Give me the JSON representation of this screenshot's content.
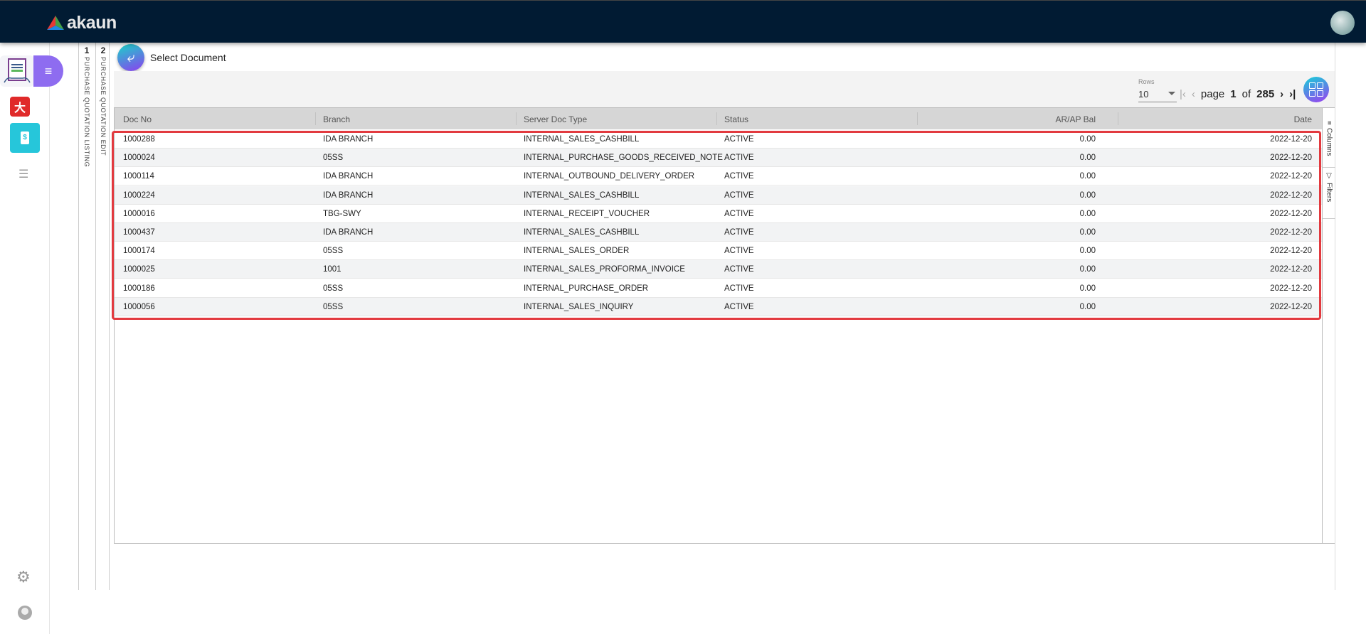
{
  "app": {
    "logo_text": "akaun"
  },
  "steps": [
    {
      "number": "1",
      "label": "PURCHASE QUOTATION LISTING"
    },
    {
      "number": "2",
      "label": "PURCHASE QUOTATION EDIT"
    }
  ],
  "page": {
    "title": "Select Document"
  },
  "pagination": {
    "rows_label": "Rows",
    "rows_value": "10",
    "page_word": "page",
    "current_page": "1",
    "of_word": "of",
    "total_pages": "285"
  },
  "table": {
    "columns": [
      "Doc No",
      "Branch",
      "Server Doc Type",
      "Status",
      "AR/AP Bal",
      "Date"
    ],
    "rows": [
      [
        "1000288",
        "IDA BRANCH",
        "INTERNAL_SALES_CASHBILL",
        "ACTIVE",
        "0.00",
        "2022-12-20"
      ],
      [
        "1000024",
        "05SS",
        "INTERNAL_PURCHASE_GOODS_RECEIVED_NOTE",
        "ACTIVE",
        "0.00",
        "2022-12-20"
      ],
      [
        "1000114",
        "IDA BRANCH",
        "INTERNAL_OUTBOUND_DELIVERY_ORDER",
        "ACTIVE",
        "0.00",
        "2022-12-20"
      ],
      [
        "1000224",
        "IDA BRANCH",
        "INTERNAL_SALES_CASHBILL",
        "ACTIVE",
        "0.00",
        "2022-12-20"
      ],
      [
        "1000016",
        "TBG-SWY",
        "INTERNAL_RECEIPT_VOUCHER",
        "ACTIVE",
        "0.00",
        "2022-12-20"
      ],
      [
        "1000437",
        "IDA BRANCH",
        "INTERNAL_SALES_CASHBILL",
        "ACTIVE",
        "0.00",
        "2022-12-20"
      ],
      [
        "1000174",
        "05SS",
        "INTERNAL_SALES_ORDER",
        "ACTIVE",
        "0.00",
        "2022-12-20"
      ],
      [
        "1000025",
        "1001",
        "INTERNAL_SALES_PROFORMA_INVOICE",
        "ACTIVE",
        "0.00",
        "2022-12-20"
      ],
      [
        "1000186",
        "05SS",
        "INTERNAL_PURCHASE_ORDER",
        "ACTIVE",
        "0.00",
        "2022-12-20"
      ],
      [
        "1000056",
        "05SS",
        "INTERNAL_SALES_INQUIRY",
        "ACTIVE",
        "0.00",
        "2022-12-20"
      ]
    ]
  },
  "side_panel": {
    "columns_label": "Columns",
    "filters_label": "Filters"
  },
  "colors": {
    "topbar": "#011b33",
    "highlight": "#e23a3f",
    "menu": "#8e6cf0",
    "teal": "#26c6da"
  }
}
